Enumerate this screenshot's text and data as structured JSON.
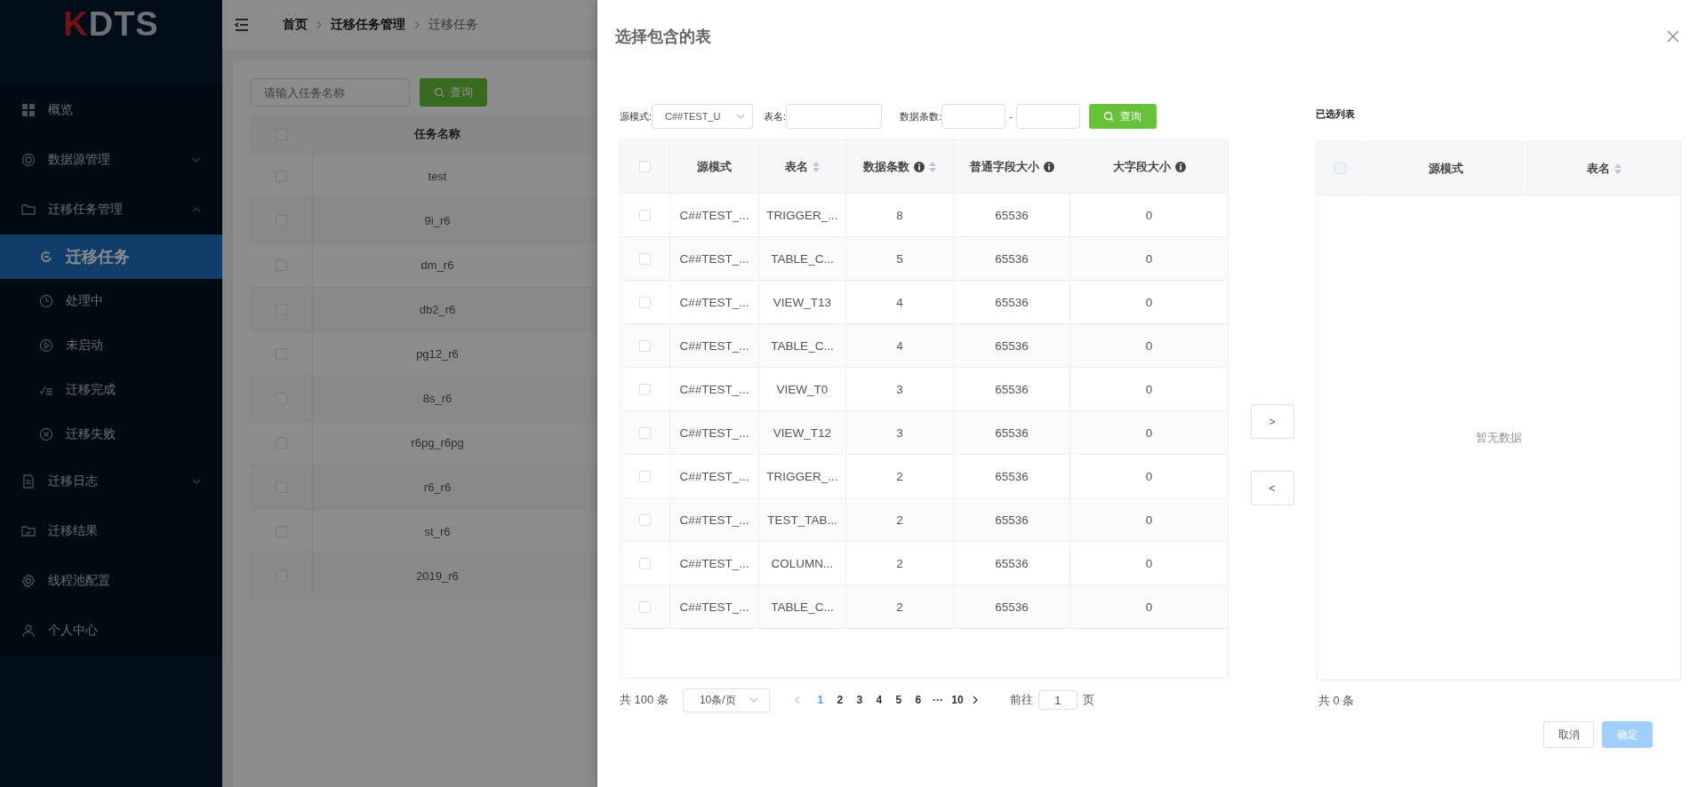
{
  "logo": {
    "text": "KDTS"
  },
  "sidebar": {
    "items": [
      {
        "label": "概览"
      },
      {
        "label": "数据源管理",
        "expanded": false
      },
      {
        "label": "迁移任务管理",
        "expanded": true,
        "children": [
          {
            "label": "迁移任务",
            "selected": true
          },
          {
            "label": "处理中",
            "selected": false
          },
          {
            "label": "未启动",
            "selected": false
          },
          {
            "label": "迁移完成",
            "selected": false
          },
          {
            "label": "迁移失败",
            "selected": false
          }
        ]
      },
      {
        "label": "迁移日志",
        "expanded": false
      },
      {
        "label": "迁移结果"
      },
      {
        "label": "线程池配置"
      },
      {
        "label": "个人中心"
      }
    ]
  },
  "breadcrumb": [
    "首页",
    "迁移任务管理",
    "迁移任务"
  ],
  "task_search": {
    "placeholder": "请输入任务名称",
    "button": "查询"
  },
  "task_table": {
    "column": "任务名称",
    "header_checked": false,
    "rows": [
      {
        "name": "test",
        "checked": false
      },
      {
        "name": "9i_r6",
        "checked": false
      },
      {
        "name": "dm_r6",
        "checked": false
      },
      {
        "name": "db2_r6",
        "checked": false
      },
      {
        "name": "pg12_r6",
        "checked": false
      },
      {
        "name": "8s_r6",
        "checked": false
      },
      {
        "name": "r6pg_r6pg",
        "checked": false
      },
      {
        "name": "r6_r6",
        "checked": false
      },
      {
        "name": "st_r6",
        "checked": false
      },
      {
        "name": "2019_r6",
        "checked": false
      }
    ]
  },
  "drawer": {
    "title": "选择包含的表",
    "filter": {
      "schema_label": "源模式:",
      "schema_value": "C##TEST_U",
      "table_label": "表名:",
      "count_label": "数据条数:",
      "range_separator": "-",
      "button": "查询"
    },
    "source_table": {
      "header_checked": false,
      "columns": [
        {
          "label": "源模式",
          "sortable": false,
          "info": false
        },
        {
          "label": "表名",
          "sortable": true,
          "info": false
        },
        {
          "label": "数据条数",
          "sortable": true,
          "info": true
        },
        {
          "label": "普通字段大小",
          "sortable": false,
          "info": true
        },
        {
          "label": "大字段大小",
          "sortable": false,
          "info": true
        }
      ],
      "rows": [
        {
          "cells": [
            "C##TEST_...",
            "TRIGGER_...",
            "8",
            "65536",
            "0"
          ],
          "checked": false
        },
        {
          "cells": [
            "C##TEST_...",
            "TABLE_C...",
            "5",
            "65536",
            "0"
          ],
          "checked": false
        },
        {
          "cells": [
            "C##TEST_...",
            "VIEW_T13",
            "4",
            "65536",
            "0"
          ],
          "checked": false
        },
        {
          "cells": [
            "C##TEST_...",
            "TABLE_C...",
            "4",
            "65536",
            "0"
          ],
          "checked": false
        },
        {
          "cells": [
            "C##TEST_...",
            "VIEW_T0",
            "3",
            "65536",
            "0"
          ],
          "checked": false
        },
        {
          "cells": [
            "C##TEST_...",
            "VIEW_T12",
            "3",
            "65536",
            "0"
          ],
          "checked": false
        },
        {
          "cells": [
            "C##TEST_...",
            "TRIGGER_...",
            "2",
            "65536",
            "0"
          ],
          "checked": false
        },
        {
          "cells": [
            "C##TEST_...",
            "TEST_TAB...",
            "2",
            "65536",
            "0"
          ],
          "checked": false
        },
        {
          "cells": [
            "C##TEST_...",
            "COLUMN...",
            "2",
            "65536",
            "0"
          ],
          "checked": false
        },
        {
          "cells": [
            "C##TEST_...",
            "TABLE_C...",
            "2",
            "65536",
            "0"
          ],
          "checked": false
        }
      ]
    },
    "pagination": {
      "total": "共 100 条",
      "page_size": "10条/页",
      "pages": [
        {
          "label": "1",
          "selected": true
        },
        {
          "label": "2",
          "selected": false
        },
        {
          "label": "3",
          "selected": false
        },
        {
          "label": "4",
          "selected": false
        },
        {
          "label": "5",
          "selected": false
        },
        {
          "label": "6",
          "selected": false
        },
        {
          "label": "···",
          "selected": false
        },
        {
          "label": "10",
          "selected": false
        }
      ],
      "prev_disabled": true,
      "goto_label": "前往",
      "goto_value": "1",
      "goto_suffix": "页"
    },
    "transfer_buttons": [
      ">",
      "<"
    ],
    "selected_title": "已选列表",
    "selected_table": {
      "header_disabled": true,
      "columns": [
        {
          "label": "源模式",
          "sortable": false
        },
        {
          "label": "表名",
          "sortable": true
        }
      ],
      "empty_text": "暂无数据"
    },
    "selected_total": "共 0 条",
    "buttons": [
      {
        "label": "取消",
        "kind": "default",
        "disabled": false
      },
      {
        "label": "确定",
        "kind": "primary",
        "disabled": true
      }
    ]
  }
}
